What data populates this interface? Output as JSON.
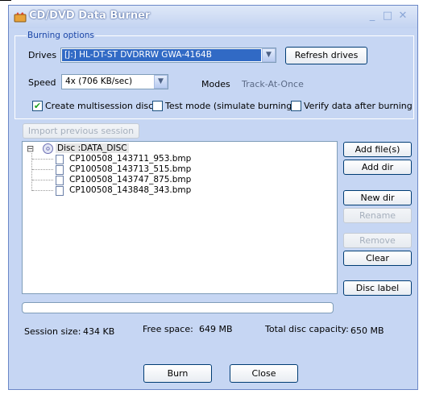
{
  "window": {
    "title": "CD/DVD Data Burner",
    "minimize": "_",
    "maximize": "□",
    "close": "✕"
  },
  "burning_options": {
    "group_label": "Burning options",
    "drives_label": "Drives",
    "drive_value": "[J:] HL-DT-ST DVDRRW GWA-4164B",
    "refresh_label": "Refresh drives",
    "speed_label": "Speed",
    "speed_value": "4x (706 KB/sec)",
    "modes_label": "Modes",
    "modes_value": "Track-At-Once",
    "create_multisession_label": "Create multisession disc",
    "create_multisession_checked": true,
    "test_mode_label": "Test mode (simulate burning)",
    "test_mode_checked": false,
    "verify_label": "Verify data after burning",
    "verify_checked": false
  },
  "import_session_label": "Import previous session",
  "tree": {
    "root_label": "Disc :DATA_DISC",
    "expander": "⊟",
    "files": [
      "CP100508_143711_953.bmp",
      "CP100508_143713_515.bmp",
      "CP100508_143747_875.bmp",
      "CP100508_143848_343.bmp"
    ]
  },
  "side_buttons": {
    "add_files": "Add file(s)",
    "add_dir": "Add dir",
    "new_dir": "New dir",
    "rename": "Rename",
    "remove": "Remove",
    "clear": "Clear",
    "disc_label": "Disc label"
  },
  "progress": {
    "value": 0
  },
  "status": {
    "session_size_label": "Session size:",
    "session_size_value": "434 KB",
    "free_space_label": "Free space:",
    "free_space_value": "649 MB",
    "total_capacity_label": "Total disc capacity:",
    "total_capacity_value": "650 MB"
  },
  "footer": {
    "burn_label": "Burn",
    "close_label": "Close"
  },
  "colors": {
    "window_bg": "#c6d6f3",
    "selection": "#316ac5",
    "group_label": "#1c47a8"
  }
}
